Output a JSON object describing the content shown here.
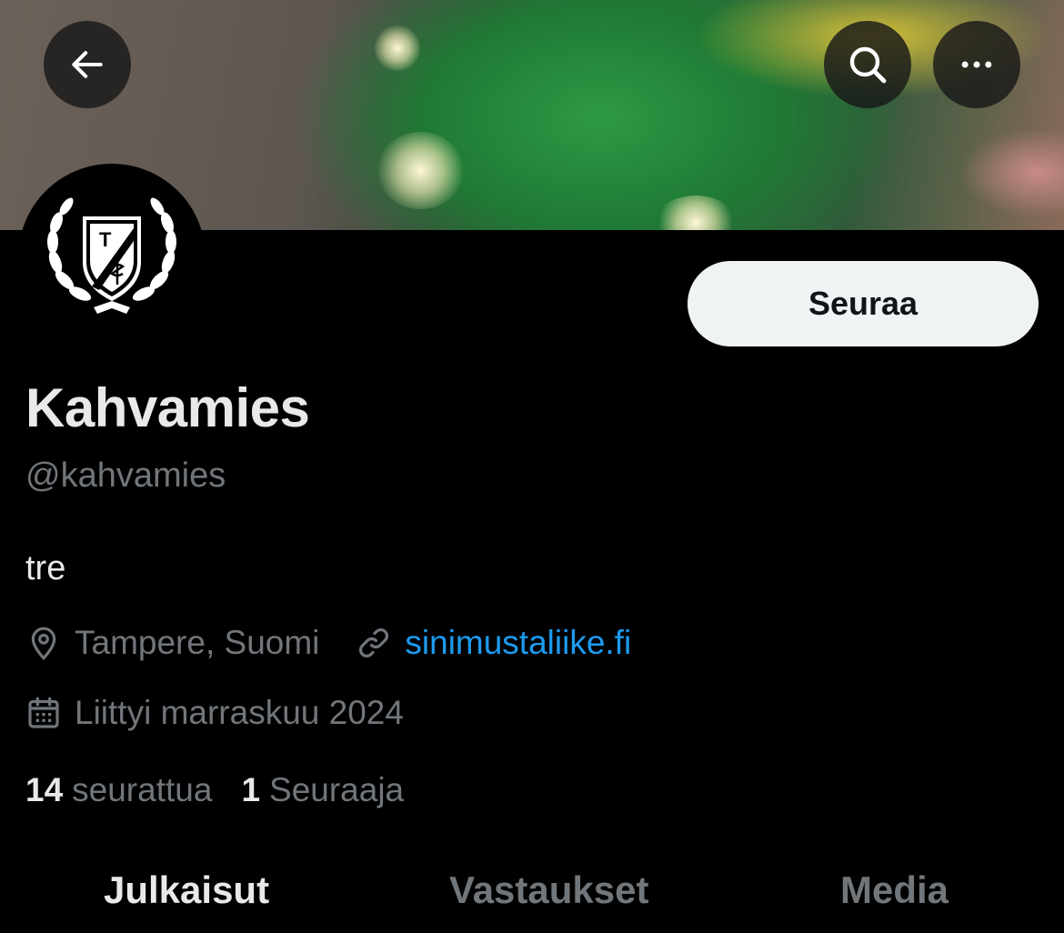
{
  "header": {
    "back_icon": "arrow-left-icon",
    "search_icon": "search-icon",
    "more_icon": "more-horizontal-icon"
  },
  "profile": {
    "display_name": "Kahvamies",
    "handle": "@kahvamies",
    "bio": "tre",
    "location": "Tampere, Suomi",
    "website": "sinimustaliike.fi",
    "joined": "Liittyi marraskuu 2024",
    "following_count": "14",
    "following_label": "seurattua",
    "followers_count": "1",
    "followers_label": "Seuraaja"
  },
  "actions": {
    "follow_label": "Seuraa"
  },
  "tabs": [
    {
      "label": "Julkaisut",
      "active": true
    },
    {
      "label": "Vastaukset",
      "active": false
    },
    {
      "label": "Media",
      "active": false
    }
  ],
  "colors": {
    "background": "#000000",
    "text_primary": "#e7e9ea",
    "text_secondary": "#71767b",
    "link": "#1d9bf0",
    "follow_button_bg": "#eff3f4"
  }
}
